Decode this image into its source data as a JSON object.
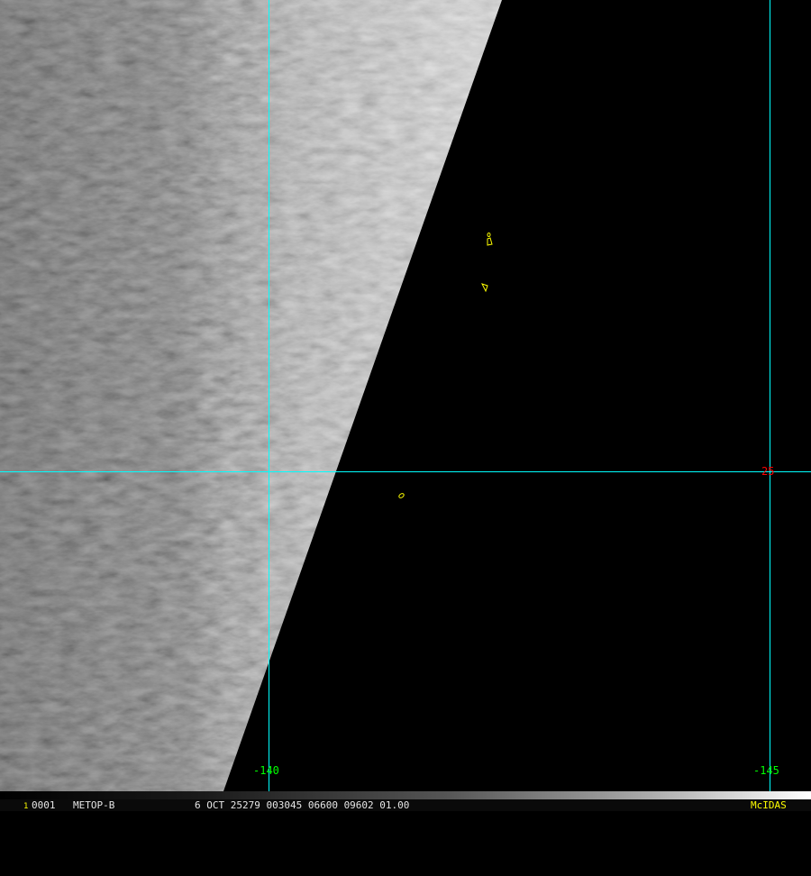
{
  "map": {
    "longitude_labels": [
      "-140",
      "-145"
    ],
    "latitude_labels": [
      "25"
    ],
    "colors": {
      "grid_lines": "#00ffff",
      "longitude_labels": "#00ff00",
      "latitude_labels": "#ff0000",
      "coastlines": "#ffff00",
      "no_data": "#000000"
    }
  },
  "status_bar": {
    "frame_number": "1",
    "frame_id": "0001",
    "satellite": "METOP-B",
    "image_info": "6 OCT 25279 003045 06600 09602 01.00",
    "software": "McIDAS"
  }
}
